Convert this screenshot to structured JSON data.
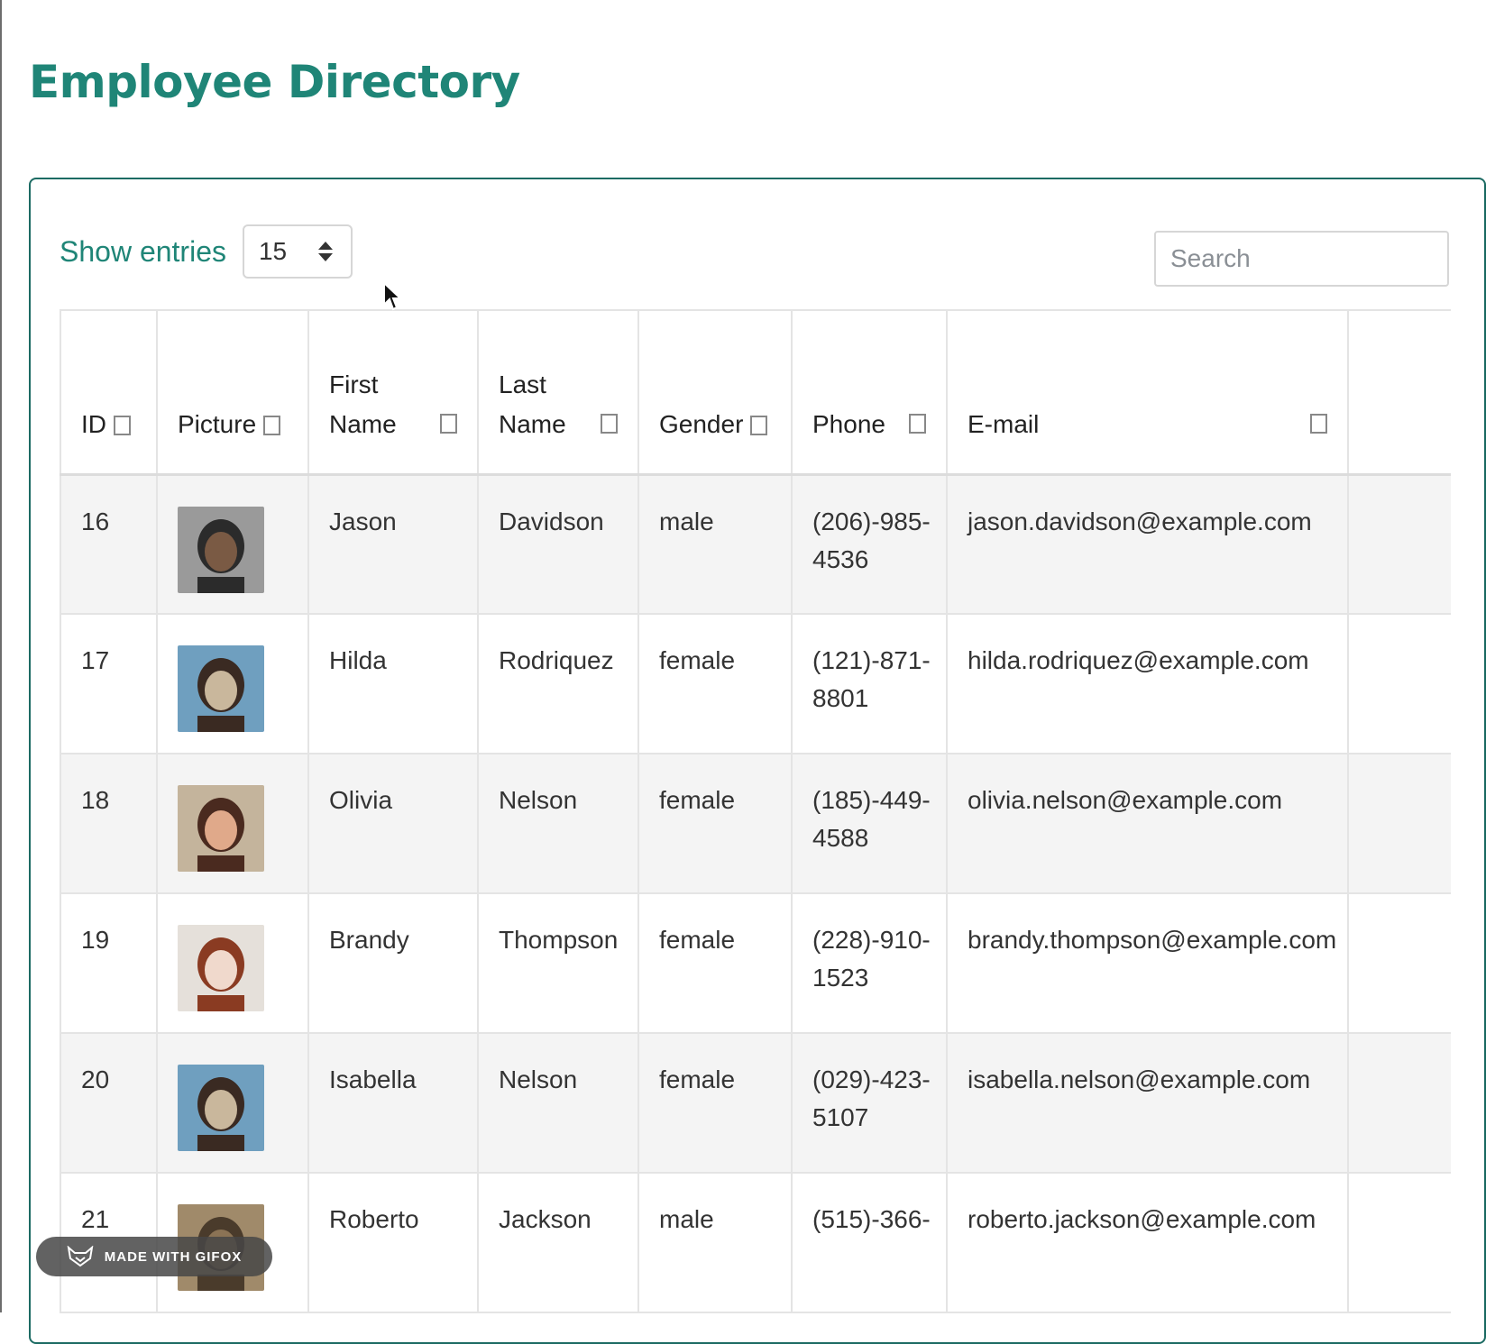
{
  "page": {
    "title": "Employee Directory"
  },
  "controls": {
    "show_entries_label": "Show entries",
    "entries_value": "15",
    "search_placeholder": "Search"
  },
  "table": {
    "columns": [
      {
        "label_line1": "",
        "label_line2": "ID"
      },
      {
        "label_line1": "",
        "label_line2": "Picture"
      },
      {
        "label_line1": "First",
        "label_line2": "Name"
      },
      {
        "label_line1": "Last",
        "label_line2": "Name"
      },
      {
        "label_line1": "",
        "label_line2": "Gender"
      },
      {
        "label_line1": "",
        "label_line2": "Phone"
      },
      {
        "label_line1": "",
        "label_line2": "E-mail"
      }
    ],
    "rows": [
      {
        "id": "16",
        "picture_icon": "avatar-icon",
        "first": "Jason",
        "last": "Davidson",
        "gender": "male",
        "phone_a": "(206)-985-",
        "phone_b": "4536",
        "email": "jason.davidson@example.com"
      },
      {
        "id": "17",
        "picture_icon": "avatar-icon",
        "first": "Hilda",
        "last": "Rodriquez",
        "gender": "female",
        "phone_a": "(121)-871-",
        "phone_b": "8801",
        "email": "hilda.rodriquez@example.com"
      },
      {
        "id": "18",
        "picture_icon": "avatar-icon",
        "first": "Olivia",
        "last": "Nelson",
        "gender": "female",
        "phone_a": "(185)-449-",
        "phone_b": "4588",
        "email": "olivia.nelson@example.com"
      },
      {
        "id": "19",
        "picture_icon": "avatar-icon",
        "first": "Brandy",
        "last": "Thompson",
        "gender": "female",
        "phone_a": "(228)-910-",
        "phone_b": "1523",
        "email": "brandy.thompson@example.com"
      },
      {
        "id": "20",
        "picture_icon": "avatar-icon",
        "first": "Isabella",
        "last": "Nelson",
        "gender": "female",
        "phone_a": "(029)-423-",
        "phone_b": "5107",
        "email": "isabella.nelson@example.com"
      },
      {
        "id": "21",
        "picture_icon": "avatar-icon",
        "first": "Roberto",
        "last": "Jackson",
        "gender": "male",
        "phone_a": "(515)-366-",
        "phone_b": "",
        "email": "roberto.jackson@example.com"
      }
    ]
  },
  "badge": {
    "text": "MADE WITH GIFOX"
  },
  "colors": {
    "accent": "#1f8577",
    "card_border": "#1c6b63",
    "stripe": "#f4f4f4"
  }
}
